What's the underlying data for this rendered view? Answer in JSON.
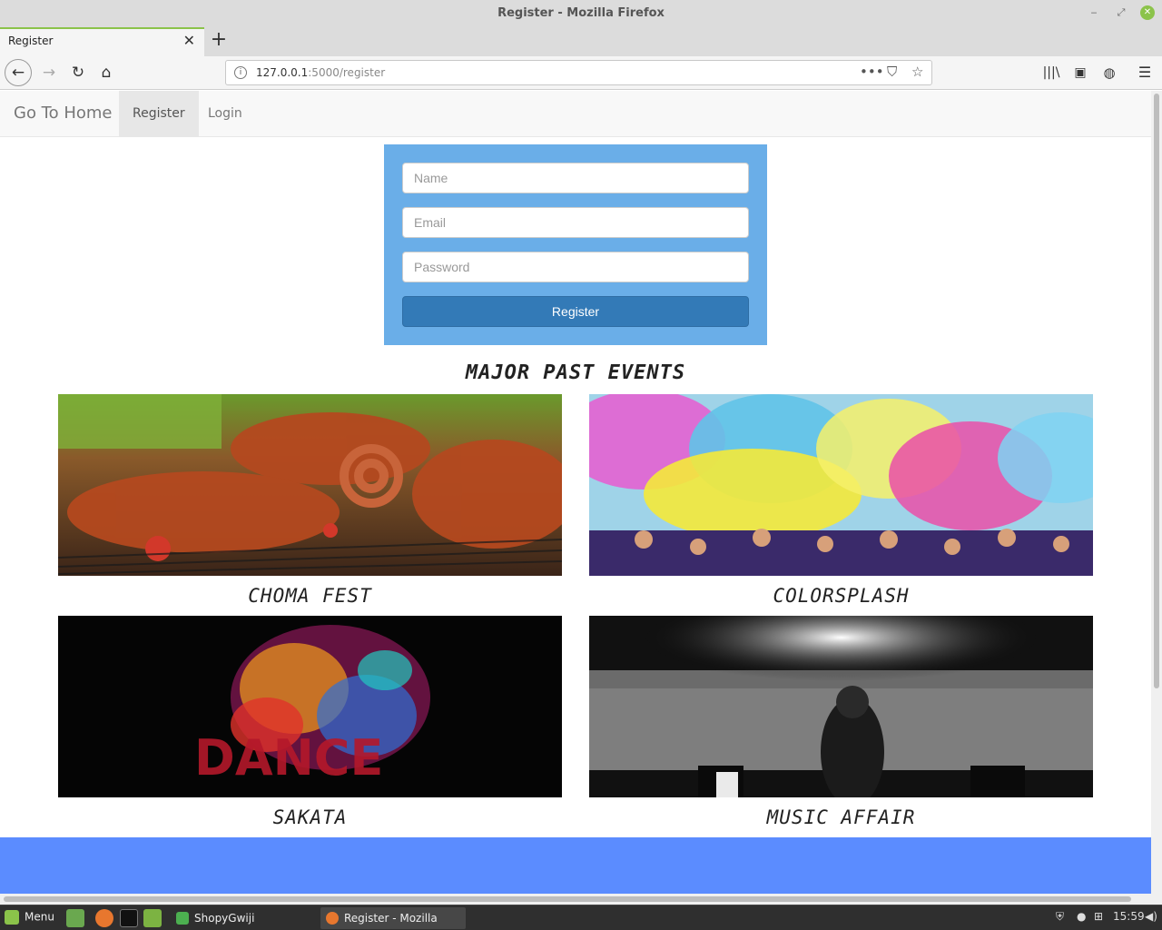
{
  "window": {
    "title": "Register - Mozilla Firefox"
  },
  "tab": {
    "label": "Register",
    "close_glyph": "✕",
    "new_glyph": "+"
  },
  "urlbar": {
    "host": "127.0.0.1",
    "rest": ":5000/register"
  },
  "sitenav": {
    "brand": "Go To Home",
    "links": [
      "Register",
      "Login"
    ]
  },
  "form": {
    "name_placeholder": "Name",
    "email_placeholder": "Email",
    "password_placeholder": "Password",
    "submit_label": "Register"
  },
  "events": {
    "heading": "MAJOR PAST EVENTS",
    "items": [
      {
        "caption": "CHOMA FEST"
      },
      {
        "caption": "COLORSPLASH"
      },
      {
        "caption": "SAKATA"
      },
      {
        "caption": "MUSIC AFFAIR"
      }
    ]
  },
  "taskbar": {
    "menu_label": "Menu",
    "tasks": [
      "ShopyGwiji [~/Pychar...",
      "Register - Mozilla Fir..."
    ],
    "clock": "15:59"
  },
  "colors": {
    "form_bg": "#6aaee8",
    "button_bg": "#337ab7",
    "footer_bg": "#5b8cff",
    "accent_green": "#8bc34a"
  }
}
